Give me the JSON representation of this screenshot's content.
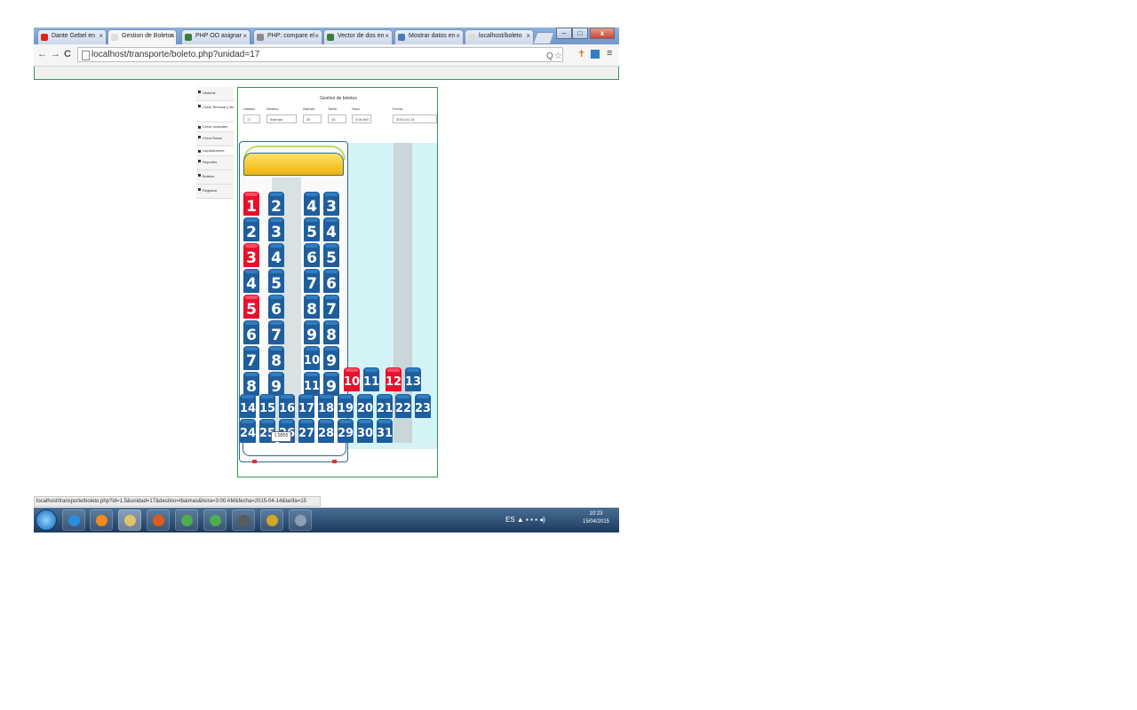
{
  "browser": {
    "tabs": [
      {
        "label": "Dante Gebel en",
        "icon_color": "#e62117",
        "active": false
      },
      {
        "label": "Gestion de Boletos",
        "icon_color": "#dddddd",
        "active": true
      },
      {
        "label": "PHP OO asignar",
        "icon_color": "#3b7d3b",
        "active": false
      },
      {
        "label": "PHP: compare el",
        "icon_color": "#8c8c8c",
        "active": false
      },
      {
        "label": "Vector de dos en",
        "icon_color": "#3b7d3b",
        "active": false
      },
      {
        "label": "Mostrar datos en",
        "icon_color": "#4a78b8",
        "active": false
      },
      {
        "label": "localhost/boleto",
        "icon_color": "#dddddd",
        "active": false
      }
    ],
    "close_glyph": "×",
    "window_controls": {
      "minimize": "–",
      "maximize": "□",
      "close": "x"
    },
    "nav": {
      "back": "←",
      "forward": "→",
      "reload": "C"
    },
    "url": "localhost/transporte/boleto.php?unidad=17",
    "toolbar_icons": {
      "search": "Q",
      "star": "☆",
      "menu": "≡"
    }
  },
  "sidebar": {
    "items": [
      {
        "label": "Historial",
        "type": "normal"
      },
      {
        "label": "Crear Terminal y Boleto",
        "type": "tall"
      },
      {
        "label": "Crear Unidades",
        "type": "small"
      },
      {
        "label": "Crear Rutas",
        "type": "normal"
      },
      {
        "label": "Liquidaciones",
        "type": "small"
      },
      {
        "label": "Reportes",
        "type": "normal"
      },
      {
        "label": "Boletos",
        "type": "normal"
      },
      {
        "label": "Registrar",
        "type": "normal"
      }
    ]
  },
  "form": {
    "title": "Gestion de boletos",
    "fields": [
      {
        "label": "Unidad",
        "value": "17"
      },
      {
        "label": "Destino",
        "value": "Ibaimas"
      },
      {
        "label": "Asiento",
        "value": "30"
      },
      {
        "label": "Tarifa",
        "value": "15"
      },
      {
        "label": "Hora",
        "value": "3:00 AM"
      },
      {
        "label": "Fecha",
        "value": "2015-04-14"
      }
    ]
  },
  "seats": [
    {
      "n": "1",
      "taken": true
    },
    {
      "n": "2",
      "taken": false
    },
    {
      "n": "4",
      "taken": false
    },
    {
      "n": "3",
      "taken": false
    },
    {
      "n": "2",
      "taken": false
    },
    {
      "n": "3",
      "taken": false
    },
    {
      "n": "5",
      "taken": false
    },
    {
      "n": "4",
      "taken": false
    },
    {
      "n": "3",
      "taken": true
    },
    {
      "n": "4",
      "taken": false
    },
    {
      "n": "6",
      "taken": false
    },
    {
      "n": "5",
      "taken": false
    },
    {
      "n": "4",
      "taken": false
    },
    {
      "n": "5",
      "taken": false
    },
    {
      "n": "7",
      "taken": false
    },
    {
      "n": "6",
      "taken": false
    },
    {
      "n": "5",
      "taken": true
    },
    {
      "n": "6",
      "taken": false
    },
    {
      "n": "8",
      "taken": false
    },
    {
      "n": "7",
      "taken": false
    },
    {
      "n": "6",
      "taken": false
    },
    {
      "n": "7",
      "taken": false
    },
    {
      "n": "9",
      "taken": false
    },
    {
      "n": "8",
      "taken": false
    },
    {
      "n": "7",
      "taken": false
    },
    {
      "n": "8",
      "taken": false
    },
    {
      "n": "10",
      "taken": false
    },
    {
      "n": "9",
      "taken": false
    },
    {
      "n": "8",
      "taken": false
    },
    {
      "n": "9",
      "taken": false
    },
    {
      "n": "11",
      "taken": false
    },
    {
      "n": "9",
      "taken": false
    },
    {
      "n": "10",
      "taken": true
    },
    {
      "n": "11",
      "taken": false
    },
    {
      "n": "12",
      "taken": true
    },
    {
      "n": "13",
      "taken": false
    },
    {
      "n": "14",
      "taken": false
    },
    {
      "n": "15",
      "taken": false
    },
    {
      "n": "16",
      "taken": false
    },
    {
      "n": "17",
      "taken": false
    },
    {
      "n": "18",
      "taken": false
    },
    {
      "n": "19",
      "taken": false
    },
    {
      "n": "20",
      "taken": false
    },
    {
      "n": "21",
      "taken": false
    },
    {
      "n": "22",
      "taken": false
    },
    {
      "n": "23",
      "taken": false
    },
    {
      "n": "24",
      "taken": false
    },
    {
      "n": "25",
      "taken": false
    },
    {
      "n": "26",
      "taken": false
    },
    {
      "n": "27",
      "taken": false
    },
    {
      "n": "28",
      "taken": false
    },
    {
      "n": "29",
      "taken": false
    },
    {
      "n": "30",
      "taken": false
    },
    {
      "n": "31",
      "taken": false
    }
  ],
  "tooltip": "1.5B55",
  "status_url": "localhost/transporte/boleto.php?id=1.5&unidad=17&destino=Ibaimas&hora=3:00 AM&fecha=2015-04-14&tarifa=15",
  "taskbar": {
    "apps": [
      "ie-icon",
      "media-player-icon",
      "explorer-icon",
      "firefox-icon",
      "chrome-icon",
      "chrome-icon",
      "sublime-icon",
      "winrar-icon",
      "tool-icon"
    ],
    "tray": "ES ▲ ▪ ▪ ▪ ◂)",
    "time": "10:23",
    "date": "15/04/2015"
  },
  "colors": {
    "seat_free": "#1f5e9c",
    "seat_taken": "#e8102c",
    "frame_green": "#2e9a50"
  }
}
